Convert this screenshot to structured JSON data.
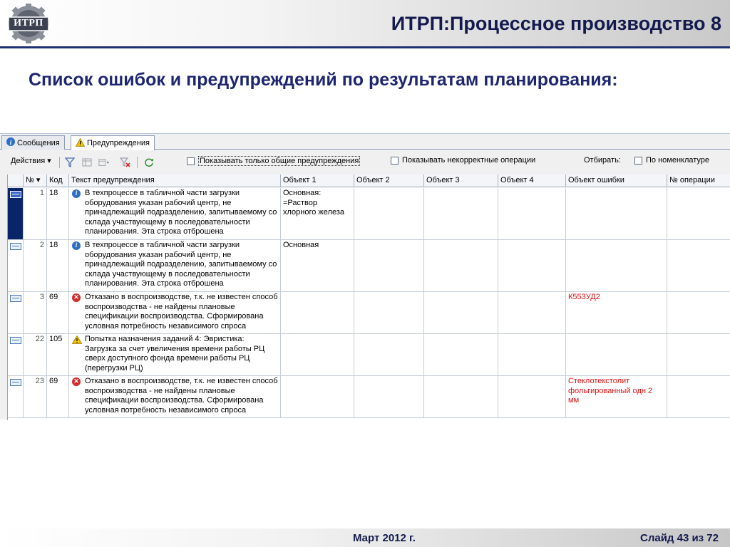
{
  "header": {
    "logo_text": "ИТРП",
    "title": "ИТРП:Процессное производство 8"
  },
  "slide": {
    "subtitle": "Список ошибок и предупреждений по результатам планирования:"
  },
  "tabs": [
    {
      "label": "Сообщения",
      "icon": "info-icon"
    },
    {
      "label": "Предупреждения",
      "icon": "warning-icon"
    }
  ],
  "toolbar": {
    "actions_label": "Действия ▾",
    "show_general_label": "Показывать только общие предупреждения",
    "show_incorrect_label": "Показывать некорректные операции",
    "filter_label": "Отбирать:",
    "by_nomenclature_label": "По номенклатуре"
  },
  "grid": {
    "columns": [
      "№ ▾",
      "Код",
      "Текст предупреждения",
      "Объект 1",
      "Объект 2",
      "Объект 3",
      "Объект 4",
      "Объект ошибки",
      "№ операции"
    ],
    "rows": [
      {
        "num": "1",
        "code": "18",
        "type": "info",
        "text": "В техпроцессе в табличной части загрузки оборудования указан рабочий центр, не принадлежащий подразделению, запитываемому со склада участвующему в последовательности планирования. Эта строка отброшена",
        "obj1": "Основная: =Раствор хлорного железа",
        "obj2": "",
        "obj3": "",
        "obj4": "",
        "err_obj": "",
        "op_num": ""
      },
      {
        "num": "2",
        "code": "18",
        "type": "info",
        "text": "В техпроцессе в табличной части загрузки оборудования указан рабочий центр, не принадлежащий подразделению, запитываемому со склада участвующему в последовательности планирования. Эта строка отброшена",
        "obj1": "Основная",
        "obj2": "",
        "obj3": "",
        "obj4": "",
        "err_obj": "",
        "op_num": ""
      },
      {
        "num": "3",
        "code": "69",
        "type": "error",
        "text": "Отказано в воспроизводстве, т.к. не известен способ воспроизводства - не найдены плановые спецификации воспроизводства. Сформирована условная потребность независимого спроса",
        "obj1": "",
        "obj2": "",
        "obj3": "",
        "obj4": "",
        "err_obj": "К553УД2",
        "op_num": ""
      },
      {
        "num": "22",
        "code": "105",
        "type": "warning",
        "text": "Попытка назначения заданий 4: Эвристика: Загрузка за счет увеличения времени работы РЦ сверх доступного фонда времени работы РЦ (перегрузки РЦ)",
        "obj1": "",
        "obj2": "",
        "obj3": "",
        "obj4": "",
        "err_obj": "",
        "op_num": ""
      },
      {
        "num": "23",
        "code": "69",
        "type": "error",
        "text": "Отказано в воспроизводстве, т.к. не известен способ воспроизводства - не найдены плановые спецификации воспроизводства. Сформирована условная потребность независимого спроса",
        "obj1": "",
        "obj2": "",
        "obj3": "",
        "obj4": "",
        "err_obj": "Стеклотекстолит фольгированный одн 2 мм",
        "op_num": ""
      }
    ]
  },
  "footer": {
    "date": "Март 2012 г.",
    "slide": "Слайд 43 из 72"
  },
  "colors": {
    "header_text": "#121a4e",
    "subtitle_text": "#1e2670",
    "accent_line": "#1f2f73",
    "error_text": "#e01010",
    "selection": "#0a246a"
  }
}
